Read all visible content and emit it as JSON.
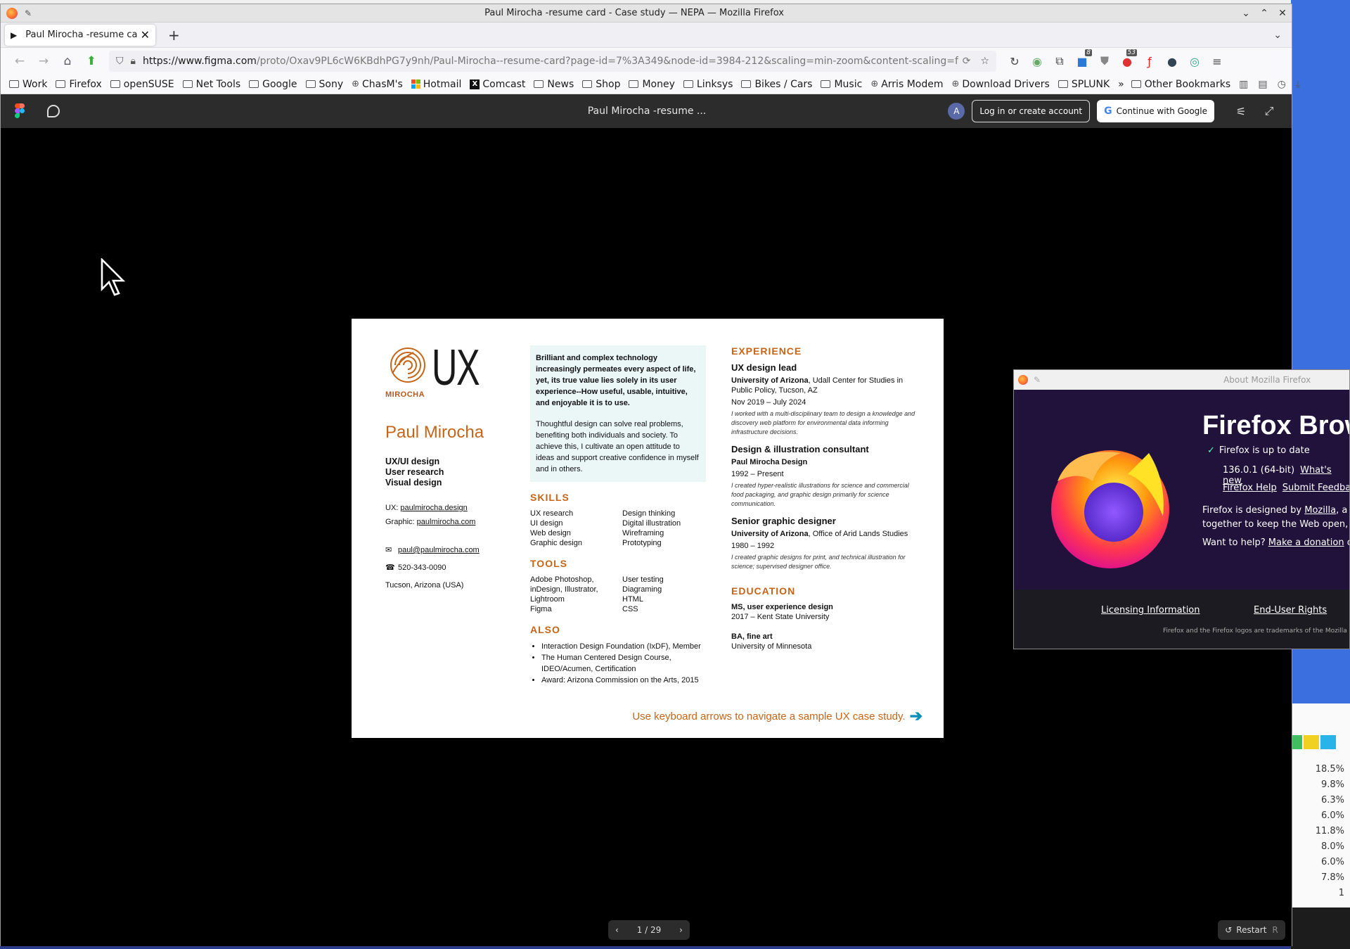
{
  "window": {
    "title": "Paul Mirocha -resume card - Case study — NEPA — Mozilla Firefox",
    "tab_label": "Paul Mirocha -resume card",
    "url_host": "https://www.figma.com",
    "url_rest": "/proto/Oxav9PL6cW6KBdhPG7y9nh/Paul-Mirocha--resume-card?page-id=7%3A349&node-id=3984-212&scaling=min-zoom&content-scaling=fixed&t=ghR",
    "extension_badges": [
      "8",
      "53"
    ]
  },
  "bookmarks": [
    {
      "label": "Work",
      "icon": "folder-icon"
    },
    {
      "label": "Firefox",
      "icon": "folder-icon"
    },
    {
      "label": "openSUSE",
      "icon": "folder-icon"
    },
    {
      "label": "Net Tools",
      "icon": "folder-icon"
    },
    {
      "label": "Google",
      "icon": "folder-icon"
    },
    {
      "label": "Sony",
      "icon": "folder-icon"
    },
    {
      "label": "ChasM's",
      "icon": "globe-icon"
    },
    {
      "label": "Hotmail",
      "icon": "microsoft-icon"
    },
    {
      "label": "Comcast",
      "icon": "x-icon"
    },
    {
      "label": "News",
      "icon": "folder-icon"
    },
    {
      "label": "Shop",
      "icon": "folder-icon"
    },
    {
      "label": "Money",
      "icon": "folder-icon"
    },
    {
      "label": "Linksys",
      "icon": "folder-icon"
    },
    {
      "label": "Bikes / Cars",
      "icon": "folder-icon"
    },
    {
      "label": "Music",
      "icon": "folder-icon"
    },
    {
      "label": "Arris Modem",
      "icon": "globe-icon"
    },
    {
      "label": "Download Drivers",
      "icon": "globe-icon"
    },
    {
      "label": "SPLUNK",
      "icon": "folder-icon"
    }
  ],
  "other_bookmarks": "Other Bookmarks",
  "figma": {
    "file_title": "Paul Mirocha -resume ...",
    "avatar_letter": "A",
    "login_label": "Log in or create account",
    "google_label": "Continue with Google",
    "pager": "1 / 29",
    "restart_label": "Restart",
    "restart_key": "R"
  },
  "resume": {
    "logo_small": "MIROCHA",
    "logo_big": "UX",
    "name": "Paul Mirocha",
    "roles": [
      "UX/UI design",
      "User research",
      "Visual design"
    ],
    "ux_prefix": "UX: ",
    "ux_link": "paulmirocha.design",
    "graphic_prefix": "Graphic: ",
    "graphic_link": "paulmirocha.com",
    "email": "paul@paulmirocha.com",
    "phone": "520-343-0090",
    "location": "Tucson, Arizona",
    "location_suffix": " (USA)",
    "quote_bold": "Brilliant and complex technology increasingly permeates every aspect of life, yet, its true value lies solely in its user experience--How useful, usable, intuitive, and enjoyable it is to use.",
    "quote_body": "Thoughtful design can solve real problems, benefiting both individuals and society. To achieve this, I cultivate an open attitude to ideas and support creative confidence in myself and in others.",
    "skills_heading": "SKILLS",
    "skills": [
      "UX research",
      "Design thinking",
      "UI design",
      "Digital illustration",
      "Web design",
      "Wireframing",
      "Graphic design",
      "Prototyping"
    ],
    "tools_heading": "TOOLS",
    "tools": [
      "Adobe Photoshop,",
      "User testing",
      "inDesign, Illustrator,",
      "Diagraming",
      "Lightroom",
      "HTML",
      "Figma",
      "CSS"
    ],
    "also_heading": "ALSO",
    "also": [
      "Interaction Design Foundation (IxDF), Member",
      "The Human Centered Design Course, IDEO/Acumen, Certification",
      "Award: Arizona Commission on the Arts, 2015"
    ],
    "experience_heading": "EXPERIENCE",
    "jobs": [
      {
        "title": "UX design lead",
        "org_bold": "University of Arizona",
        "org_rest": ", Udall Center for Studies in Public Policy, Tucson, AZ",
        "dates": "Nov 2019 – July 2024",
        "desc": "I worked with a multi-disciplinary team to design a knowledge and discovery web platform for environmental data informing infrastructure decisions."
      },
      {
        "title": "Design & illustration consultant",
        "org_bold": "Paul Mirocha Design",
        "org_rest": "",
        "dates": "1992 – Present",
        "desc": "I created hyper-realistic illustrations for science and commercial food packaging, and graphic design primarily for science communication."
      },
      {
        "title": "Senior graphic designer",
        "org_bold": "University of Arizona",
        "org_rest": ", Office of Arid Lands Studies",
        "dates": "1980 – 1992",
        "desc": "I created graphic designs for print, and technical illustration for science; supervised designer office."
      }
    ],
    "education_heading": "EDUCATION",
    "education": [
      {
        "degree": "MS, user experience design",
        "school": "2017 – Kent State University"
      },
      {
        "degree": "BA, fine art",
        "school": "University of Minnesota"
      }
    ],
    "cta": "Use keyboard arrows to navigate a sample UX case study."
  },
  "about": {
    "title": "About Mozilla Firefox",
    "brand": "Firefox Brow",
    "status": "Firefox is up to date",
    "version": "136.0.1 (64-bit)",
    "whats_new": "What's new",
    "help": "Firefox Help",
    "feedback": "Submit Feedba",
    "designed_1a": "Firefox is designed by ",
    "designed_link": "Mozilla",
    "designed_1b": ", a g",
    "designed_2": "together to keep the Web open, p",
    "want_help": "Want to help? ",
    "donation": "Make a donation",
    "donation_suffix": " or",
    "licensing": "Licensing Information",
    "eula": "End-User Rights",
    "trademark": "Firefox and the Firefox logos are trademarks of the Mozilla Fou"
  },
  "background": {
    "percentages": [
      "18.5%",
      "9.8%",
      "6.3%",
      "6.0%",
      "11.8%",
      "8.0%",
      "6.0%",
      "7.8%",
      "1"
    ],
    "bar_colors": [
      "#3fbf5f",
      "#f0d020",
      "#2ab3e8"
    ]
  }
}
